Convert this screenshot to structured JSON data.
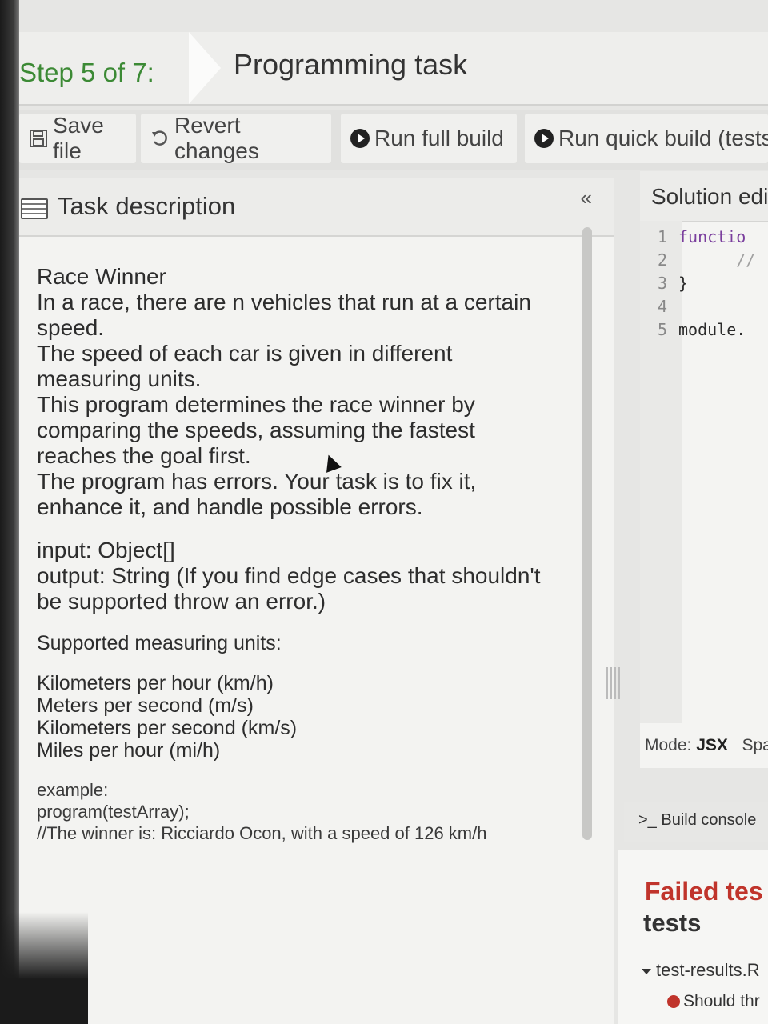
{
  "header": {
    "step_label": "Step 5 of 7:",
    "title": "Programming task"
  },
  "toolbar": {
    "save_label": "Save file",
    "revert_label": "Revert changes",
    "run_full_label": "Run full build",
    "run_quick_label": "Run quick build (tests"
  },
  "task_panel": {
    "title": "Task description",
    "collapse_label": "«",
    "heading": "Race Winner",
    "intro_1": "In a race, there are n vehicles that run at a certain speed.",
    "intro_2": "The speed of each car is given in different measuring units.",
    "intro_3": "This program determines the race winner by comparing the speeds, assuming the fastest reaches the goal first.",
    "intro_4": "The program has errors. Your task is to fix it, enhance it, and handle possible errors.",
    "input": "input: Object[]",
    "output": "output: String (If you find edge cases that shouldn't be supported throw an error.)",
    "units_heading": "Supported measuring units:",
    "units": [
      "Kilometers per hour (km/h)",
      "Meters per second (m/s)",
      "Kilometers per second (km/s)",
      "Miles per hour (mi/h)"
    ],
    "example_label": "example:",
    "example_call": "program(testArray);",
    "example_comment": "//The winner is: Ricciardo Ocon, with a speed of 126 km/h"
  },
  "editor": {
    "title": "Solution edi",
    "lines": [
      {
        "n": "1",
        "text": "functio",
        "kind": "kw",
        "indent": ""
      },
      {
        "n": "2",
        "text": "//",
        "kind": "cm",
        "indent": "      "
      },
      {
        "n": "3",
        "text": "}",
        "kind": "plain",
        "indent": ""
      },
      {
        "n": "4",
        "text": "",
        "kind": "plain",
        "indent": ""
      },
      {
        "n": "5",
        "text": "module.",
        "kind": "plain",
        "indent": ""
      }
    ],
    "mode_label": "Mode:",
    "mode_value": "JSX",
    "spaces_label": "Spa"
  },
  "console": {
    "label": ">_ Build console",
    "failed_title": "Failed tes",
    "tests_label": "tests",
    "file_label": "test-results.R",
    "should_label": "Should thr"
  },
  "colors": {
    "step_green": "#3c8a35",
    "fail_red": "#c0342b",
    "keyword_purple": "#7a3e9d"
  }
}
